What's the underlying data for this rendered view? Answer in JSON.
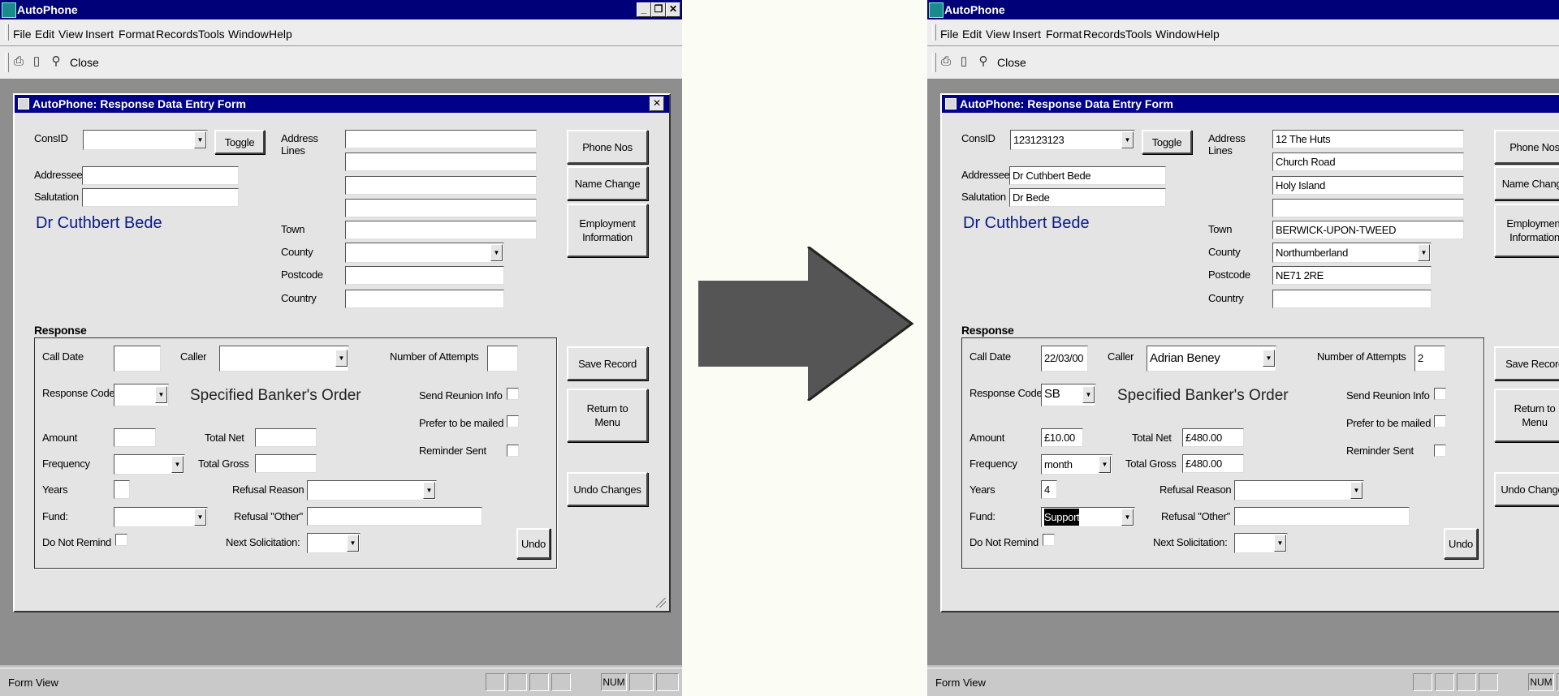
{
  "app": {
    "title": "AutoPhone",
    "menu": [
      "File",
      "Edit",
      "View",
      "Insert",
      "Format",
      "Records",
      "Tools",
      "Window",
      "Help"
    ],
    "toolbar": {
      "close_label": "Close"
    },
    "status": {
      "text": "Form View",
      "num": "NUM"
    },
    "window_controls": [
      "minimize-icon",
      "restore-icon",
      "close-icon"
    ]
  },
  "form": {
    "title": "AutoPhone: Response Data Entry Form",
    "labels": {
      "consid": "ConsID",
      "toggle": "Toggle",
      "address1": "Address",
      "address2": "Lines",
      "addressee": "Addressee",
      "salutation": "Salutation",
      "town": "Town",
      "county": "County",
      "postcode": "Postcode",
      "country": "Country",
      "phone_nos": "Phone Nos",
      "name_change": "Name Change",
      "employment1": "Employment",
      "employment2": "Information",
      "response": "Response",
      "call_date": "Call Date",
      "caller": "Caller",
      "attempts": "Number of Attempts",
      "response_code": "Response Code",
      "send_reunion": "Send Reunion Info",
      "prefer_mailed": "Prefer to be mailed",
      "reminder_sent": "Reminder Sent",
      "amount": "Amount",
      "total_net": "Total Net",
      "frequency": "Frequency",
      "total_gross": "Total Gross",
      "years": "Years",
      "refusal_reason": "Refusal Reason",
      "fund": "Fund:",
      "refusal_other": "Refusal \"Other\"",
      "do_not_remind": "Do Not Remind",
      "next_solicitation": "Next Solicitation:",
      "undo": "Undo",
      "save_record": "Save Record",
      "return1": "Return to",
      "return2": "Menu",
      "undo_changes": "Undo Changes"
    }
  },
  "before": {
    "consid": "",
    "addressee": "",
    "salutation": "",
    "display_name": "Dr Cuthbert Bede",
    "address_lines": [
      "",
      "",
      "",
      ""
    ],
    "town": "",
    "county": "",
    "postcode": "",
    "country": "",
    "call_date": "",
    "caller": "",
    "attempts": "",
    "response_code": "",
    "response_code_text": "Specified Banker's Order",
    "amount": "",
    "total_net": "",
    "frequency": "",
    "total_gross": "",
    "years": "",
    "refusal_reason": "",
    "fund": "",
    "refusal_other": "",
    "next_solicitation": ""
  },
  "after": {
    "consid": "123123123",
    "addressee": "Dr Cuthbert Bede",
    "salutation": "Dr Bede",
    "display_name": "Dr Cuthbert Bede",
    "address_lines": [
      "12 The Huts",
      "Church Road",
      "Holy Island",
      ""
    ],
    "town": "BERWICK-UPON-TWEED",
    "county": "Northumberland",
    "postcode": "NE71 2RE",
    "country": "",
    "call_date": "22/03/00",
    "caller": "Adrian Beney",
    "attempts": "2",
    "response_code": "SB",
    "response_code_text": "Specified Banker's Order",
    "amount": "£10.00",
    "total_net": "£480.00",
    "frequency": "month",
    "total_gross": "£480.00",
    "years": "4",
    "refusal_reason": "",
    "fund": "Support",
    "refusal_other": "",
    "next_solicitation": ""
  },
  "colors": {
    "titlebar": "#000078",
    "form_title": "#000088",
    "name_text": "#0a1a8a",
    "arrow": "#555555",
    "background": "#fbfcf3"
  }
}
